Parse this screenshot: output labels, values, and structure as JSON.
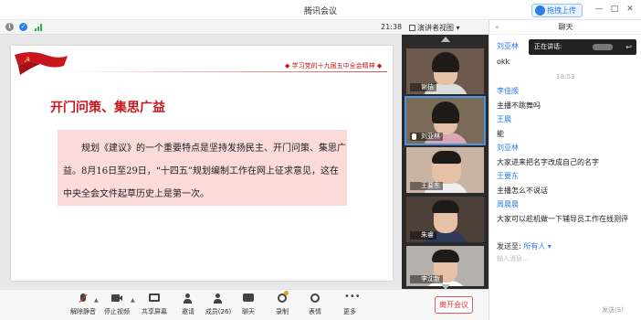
{
  "window": {
    "title": "腾讯会议",
    "upload_label": "拖拽上传",
    "minimize": "—",
    "maximize": "□",
    "close": "✕"
  },
  "infobar": {
    "time": "21:38"
  },
  "view": {
    "label": "演讲者视图",
    "caret": "▾"
  },
  "slide": {
    "header": "学习党的十九届五中全会精神",
    "title": "开门问策、集思广益",
    "body": "规划《建议》的一个重要特点是坚持发扬民主、开门问策、集思广益。8月16日至29日，“十四五”规划编制工作在网上征求意见，这在中央全会文件起草历史上是第一次。"
  },
  "participants": [
    {
      "name": "谢桔"
    },
    {
      "name": "刘亚林"
    },
    {
      "name": "王要东"
    },
    {
      "name": "朱睿"
    },
    {
      "name": "李沈新"
    }
  ],
  "toolbar": {
    "items": [
      {
        "label": "解除静音",
        "icon": "mic-off-icon"
      },
      {
        "label": "停止视频",
        "icon": "video-icon"
      },
      {
        "label": "共享屏幕",
        "icon": "share-screen-icon"
      },
      {
        "label": "邀请",
        "icon": "invite-icon"
      },
      {
        "label": "成员(26)",
        "icon": "members-icon"
      },
      {
        "label": "聊天",
        "icon": "chat-icon"
      },
      {
        "label": "录制",
        "icon": "record-icon"
      },
      {
        "label": "表情",
        "icon": "emoji-icon"
      },
      {
        "label": "更多",
        "icon": "more-icon"
      }
    ],
    "leave_label": "离开会议"
  },
  "chat": {
    "title": "聊天",
    "speaking_label": "正在讲话:",
    "messages": [
      {
        "name": "刘亚林",
        "text": "okk"
      },
      {
        "name": "李佳顺",
        "text": "主播不跳舞吗"
      },
      {
        "name": "王晨",
        "text": "能"
      },
      {
        "name": "刘亚林",
        "text": "大家进来把名字改成自己的名字"
      },
      {
        "name": "王要东",
        "text": "主播怎么不说话"
      },
      {
        "name": "周晨晨",
        "text": "大家可以趁机做一下辅导员工作在线测评"
      }
    ],
    "timestamp": "18:53",
    "send_to_label": "发送至:",
    "send_to_value": "所有人",
    "input_placeholder": "输入消息...",
    "send_label": "发送(S)"
  },
  "colors": {
    "accent": "#2d7ee8",
    "party_red": "#c8161d",
    "highlight_box": "#fbdada"
  }
}
